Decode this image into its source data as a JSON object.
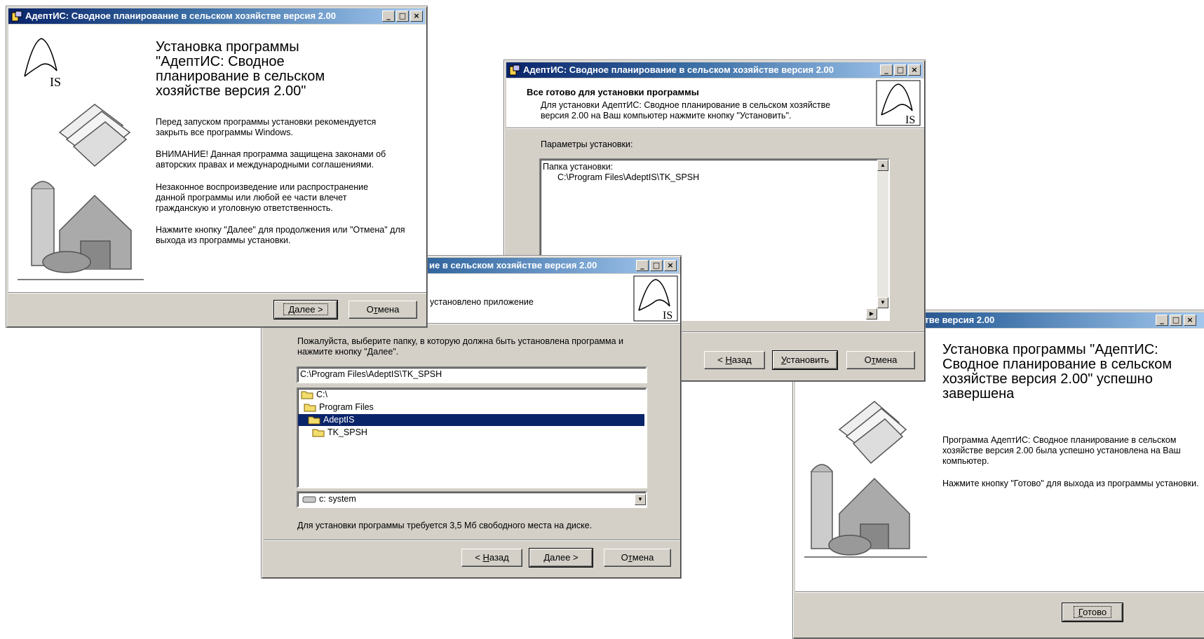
{
  "window_title": "АдептИС: Сводное планирование в сельском хозяйстве версия 2.00",
  "titlebar_buttons": {
    "minimize": "_",
    "maximize": "□",
    "close": "×"
  },
  "logo_text": "IS",
  "welcome": {
    "heading": "Установка программы \"АдептИС: Сводное планирование в сельском хозяйстве версия 2.00\"",
    "p1": "Перед запуском программы установки рекомендуется закрыть все программы Windows.",
    "p2": "ВНИМАНИЕ! Данная программа защищена законами об авторских правах и международными соглашениями.",
    "p3": "Незаконное воспроизведение или распространение данной программы или любой ее части влечет гражданскую и уголовную ответственность.",
    "p4": "Нажмите кнопку \"Далее\" для продолжения или \"Отмена\" для выхода из программы установки.",
    "next": {
      "pre": "",
      "u": "Д",
      "post": "алее >"
    },
    "cancel": {
      "pre": "О",
      "u": "т",
      "post": "мена"
    }
  },
  "folder": {
    "title_visible": "ие в сельском хозяйстве версия 2.00",
    "header_text": "установлено приложение",
    "instruction": "Пожалуйста, выберите папку, в которую должна быть установлена программа и нажмите кнопку \"Далее\".",
    "path_value": "C:\\Program Files\\AdeptIS\\TK_SPSH",
    "tree": [
      {
        "label": "C:\\",
        "selected": false
      },
      {
        "label": "Program Files",
        "selected": false
      },
      {
        "label": "AdeptIS",
        "selected": true
      },
      {
        "label": "TK_SPSH",
        "selected": false
      }
    ],
    "drive": "c: system",
    "space_note": "Для установки программы требуется 3,5 Мб свободного места на диске.",
    "back": {
      "pre": "< ",
      "u": "Н",
      "post": "азад"
    },
    "next": {
      "pre": "",
      "u": "Д",
      "post": "алее >"
    },
    "cancel": {
      "pre": "О",
      "u": "т",
      "post": "мена"
    }
  },
  "ready": {
    "header_title": "Все готово для установки программы",
    "header_sub": "Для установки АдептИС: Сводное планирование в сельском хозяйстве версия 2.00 на Ваш компьютер нажмите кнопку \"Установить\".",
    "params_label": "Параметры установки:",
    "params_line1": "Папка установки:",
    "params_line2": "C:\\Program Files\\AdeptIS\\TK_SPSH",
    "back": {
      "pre": "< ",
      "u": "Н",
      "post": "азад"
    },
    "install": {
      "pre": "",
      "u": "У",
      "post": "становить"
    },
    "cancel": {
      "pre": "О",
      "u": "т",
      "post": "мена"
    }
  },
  "finish": {
    "title_visible": "ирование в сельском хозяйстве версия 2.00",
    "heading": "Установка программы \"АдептИС: Сводное планирование в сельском хозяйстве версия 2.00\" успешно завершена",
    "p1": "Программа АдептИС: Сводное планирование в сельском хозяйстве версия 2.00 была успешно установлена на Ваш компьютер.",
    "p2": "Нажмите кнопку \"Готово\" для выхода из программы установки.",
    "done": {
      "pre": "",
      "u": "Г",
      "post": "отово"
    }
  },
  "colors": {
    "face": "#d4d0c8",
    "title_dark": "#0a246a",
    "title_light": "#a6caf0",
    "selection": "#0a246a"
  }
}
